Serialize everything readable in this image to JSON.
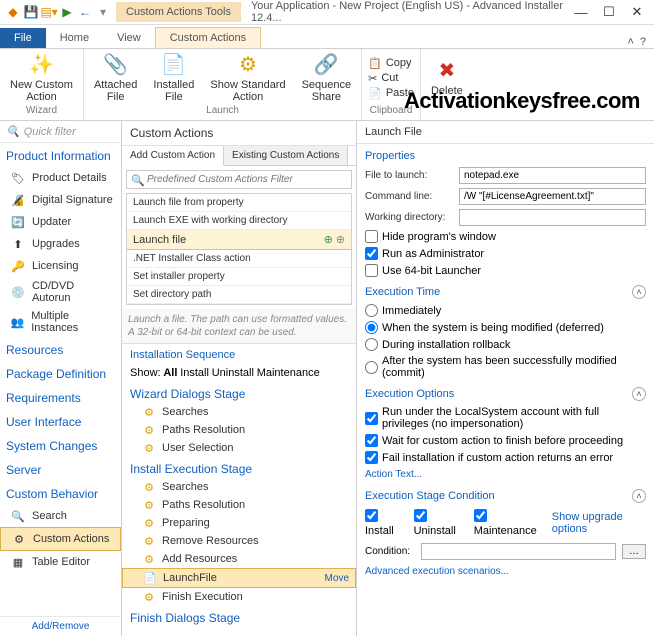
{
  "title": "Your Application - New Project (English US) - Advanced Installer 12.4...",
  "contextual_tab": "Custom Actions Tools",
  "ribbon_tabs": {
    "file": "File",
    "home": "Home",
    "view": "View",
    "custom_actions": "Custom Actions"
  },
  "ribbon": {
    "wizard": {
      "new_custom_action": "New Custom\nAction",
      "label": "Wizard"
    },
    "launch": {
      "attached_file": "Attached\nFile",
      "installed_file": "Installed\nFile",
      "show_standard_action": "Show Standard\nAction",
      "sequence_share": "Sequence\nShare",
      "label": "Launch"
    },
    "clipboard": {
      "copy": "Copy",
      "cut": "Cut",
      "paste": "Paste",
      "label": "Clipboard"
    },
    "delete": "Delete"
  },
  "watermark": "Activationkeysfree.com",
  "quickfilter_placeholder": "Quick filter",
  "nav": {
    "product_information": "Product Information",
    "product_details": "Product Details",
    "digital_signature": "Digital Signature",
    "updater": "Updater",
    "upgrades": "Upgrades",
    "licensing": "Licensing",
    "cddvd_autorun": "CD/DVD Autorun",
    "multiple_instances": "Multiple Instances",
    "resources": "Resources",
    "package_definition": "Package Definition",
    "requirements": "Requirements",
    "user_interface": "User Interface",
    "system_changes": "System Changes",
    "server": "Server",
    "custom_behavior": "Custom Behavior",
    "search": "Search",
    "custom_actions": "Custom Actions",
    "table_editor": "Table Editor",
    "footer": "Add/Remove"
  },
  "mid": {
    "title": "Custom Actions",
    "tab_add": "Add Custom Action",
    "tab_existing": "Existing Custom Actions",
    "filter_placeholder": "Predefined Custom Actions Filter",
    "actions": {
      "launch_file_from_property": "Launch file from property",
      "launch_exe_working_dir": "Launch EXE with working directory",
      "launch_file": "Launch file",
      "dotnet_installer": ".NET Installer Class action",
      "set_installer_property": "Set installer property",
      "set_directory_path": "Set directory path"
    },
    "hint": "Launch a file. The path can use formatted values. A 32-bit or 64-bit context can be used.",
    "seq_header": "Installation Sequence",
    "show_label": "Show:",
    "filter_all": "All",
    "filter_install": "Install",
    "filter_uninstall": "Uninstall",
    "filter_maintenance": "Maintenance",
    "wizard_stage": "Wizard Dialogs Stage",
    "searches": "Searches",
    "paths_resolution": "Paths Resolution",
    "user_selection": "User Selection",
    "install_stage": "Install Execution Stage",
    "preparing": "Preparing",
    "remove_resources": "Remove Resources",
    "add_resources": "Add Resources",
    "launchfile": "LaunchFile",
    "move": "Move",
    "finish_execution": "Finish Execution",
    "finish_stage": "Finish Dialogs Stage"
  },
  "right": {
    "title": "Launch File",
    "properties": "Properties",
    "file_to_launch_label": "File to launch:",
    "file_to_launch": "notepad.exe",
    "command_line_label": "Command line:",
    "command_line": "/W \"[#LicenseAgreement.txt]\"",
    "working_dir_label": "Working directory:",
    "working_dir": "",
    "hide_window": "Hide program's window",
    "run_admin": "Run as Administrator",
    "use_64bit": "Use 64-bit Launcher",
    "exec_time": "Execution Time",
    "immediately": "Immediately",
    "deferred": "When the system is being modified (deferred)",
    "rollback": "During installation rollback",
    "commit": "After the system has been successfully modified (commit)",
    "exec_options": "Execution Options",
    "localsystem": "Run under the LocalSystem account with full privileges (no impersonation)",
    "wait_finish": "Wait for custom action to finish before proceeding",
    "fail_on_error": "Fail installation if custom action returns an error",
    "action_text": "Action Text...",
    "stage_cond": "Execution Stage Condition",
    "install": "Install",
    "uninstall": "Uninstall",
    "maintenance": "Maintenance",
    "show_upgrade": "Show upgrade options",
    "condition_label": "Condition:",
    "condition": "",
    "adv_scenarios": "Advanced execution scenarios..."
  }
}
